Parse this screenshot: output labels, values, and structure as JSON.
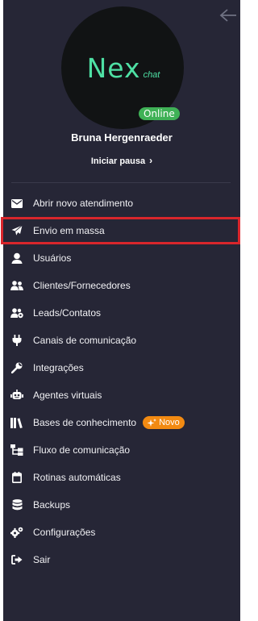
{
  "profile": {
    "logo_main": "Nex",
    "logo_sub": "chat",
    "status": "Online",
    "user_name": "Bruna Hergenraeder",
    "pause_label": "Iniciar pausa"
  },
  "menu": {
    "items": [
      {
        "label": "Abrir novo atendimento",
        "icon": "envelope-icon"
      },
      {
        "label": "Envio em massa",
        "icon": "paper-plane-icon",
        "highlighted": true
      },
      {
        "label": "Usuários",
        "icon": "user-icon"
      },
      {
        "label": "Clientes/Fornecedores",
        "icon": "users-icon"
      },
      {
        "label": "Leads/Contatos",
        "icon": "users-cog-icon"
      },
      {
        "label": "Canais de comunicação",
        "icon": "plug-icon"
      },
      {
        "label": "Integrações",
        "icon": "wrench-icon"
      },
      {
        "label": "Agentes virtuais",
        "icon": "robot-icon"
      },
      {
        "label": "Bases de conhecimento",
        "icon": "books-icon",
        "badge": "Novo"
      },
      {
        "label": "Fluxo de comunicação",
        "icon": "sitemap-icon"
      },
      {
        "label": "Rotinas automáticas",
        "icon": "calendar-icon"
      },
      {
        "label": "Backups",
        "icon": "database-icon"
      },
      {
        "label": "Configurações",
        "icon": "cogs-icon"
      },
      {
        "label": "Sair",
        "icon": "sign-out-icon"
      }
    ]
  },
  "colors": {
    "sidebar_bg": "#262636",
    "accent_logo": "#4ee0a4",
    "online": "#3fb156",
    "new_badge": "#f28a12",
    "highlight_border": "#d9262c"
  }
}
